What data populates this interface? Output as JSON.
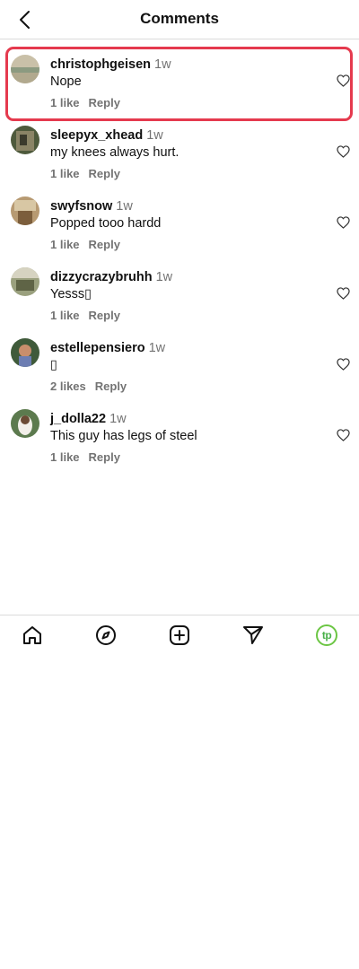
{
  "header": {
    "title": "Comments"
  },
  "comments": [
    {
      "username": "christophgeisen",
      "time": "1w",
      "text": "Nope",
      "likes": "1 like",
      "reply": "Reply"
    },
    {
      "username": "sleepyx_xhead",
      "time": "1w",
      "text": "my knees always hurt.",
      "likes": "1 like",
      "reply": "Reply"
    },
    {
      "username": "swyfsnow",
      "time": "1w",
      "text": "Popped tooo hardd",
      "likes": "1 like",
      "reply": "Reply"
    },
    {
      "username": "dizzycrazybruhh",
      "time": "1w",
      "text": "Yesss▯",
      "likes": "1 like",
      "reply": "Reply"
    },
    {
      "username": "estellepensiero",
      "time": "1w",
      "text": "▯",
      "likes": "2 likes",
      "reply": "Reply"
    },
    {
      "username": "j_dolla22",
      "time": "1w",
      "text": "This guy has legs of steel",
      "likes": "1 like",
      "reply": "Reply"
    }
  ],
  "nav": {
    "profile_badge": "tp"
  },
  "colors": {
    "highlight": "#e53a4e",
    "muted": "#737373",
    "profile_ring": "#6cc644"
  }
}
